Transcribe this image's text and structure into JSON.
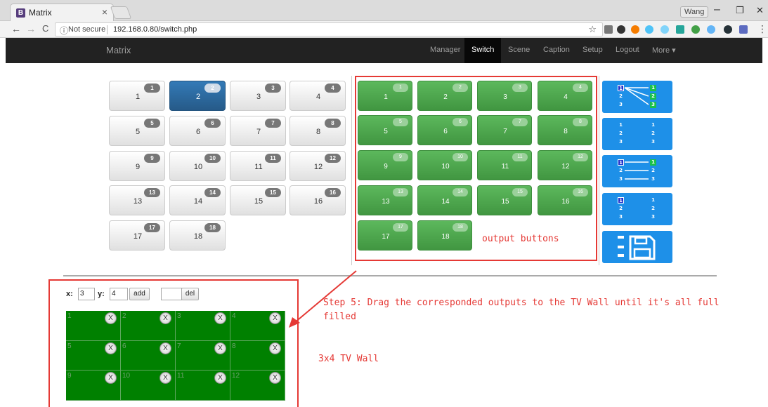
{
  "browser": {
    "tab_title": "Matrix",
    "tab_icon_letter": "B",
    "tab_close": "×",
    "user_name": "Wang",
    "window_minimize": "–",
    "window_restore": "❐",
    "window_close": "✕",
    "nav_back": "←",
    "nav_forward": "→",
    "nav_reload": "C",
    "secure_text": "Not secure",
    "url": "192.168.0.80/switch.php",
    "menu_icon": "⋮"
  },
  "navbar": {
    "brand": "Matrix",
    "links": [
      "Manager",
      "Switch",
      "Scene",
      "Caption",
      "Setup",
      "Logout",
      "More ▾"
    ],
    "active": "Switch"
  },
  "inputs": [
    {
      "label": "1",
      "badge": "1"
    },
    {
      "label": "2",
      "badge": "2",
      "active": true
    },
    {
      "label": "3",
      "badge": "3"
    },
    {
      "label": "4",
      "badge": "4"
    },
    {
      "label": "5",
      "badge": "5"
    },
    {
      "label": "6",
      "badge": "6"
    },
    {
      "label": "7",
      "badge": "7"
    },
    {
      "label": "8",
      "badge": "8"
    },
    {
      "label": "9",
      "badge": "9"
    },
    {
      "label": "10",
      "badge": "10"
    },
    {
      "label": "11",
      "badge": "11"
    },
    {
      "label": "12",
      "badge": "12"
    },
    {
      "label": "13",
      "badge": "13"
    },
    {
      "label": "14",
      "badge": "14"
    },
    {
      "label": "15",
      "badge": "15"
    },
    {
      "label": "16",
      "badge": "16"
    },
    {
      "label": "17",
      "badge": "17"
    },
    {
      "label": "18",
      "badge": "18"
    }
  ],
  "outputs": [
    {
      "label": "1",
      "badge": "1"
    },
    {
      "label": "2",
      "badge": "2"
    },
    {
      "label": "3",
      "badge": "3"
    },
    {
      "label": "4",
      "badge": "4"
    },
    {
      "label": "5",
      "badge": "5"
    },
    {
      "label": "6",
      "badge": "6"
    },
    {
      "label": "7",
      "badge": "7"
    },
    {
      "label": "8",
      "badge": "8"
    },
    {
      "label": "9",
      "badge": "9"
    },
    {
      "label": "10",
      "badge": "10"
    },
    {
      "label": "11",
      "badge": "11"
    },
    {
      "label": "12",
      "badge": "12"
    },
    {
      "label": "13",
      "badge": "13"
    },
    {
      "label": "14",
      "badge": "14"
    },
    {
      "label": "15",
      "badge": "15"
    },
    {
      "label": "16",
      "badge": "16"
    },
    {
      "label": "17",
      "badge": "17"
    },
    {
      "label": "18",
      "badge": "18"
    }
  ],
  "mode_buttons": [
    {
      "name": "one-to-all-mode-icon",
      "left": [
        "1",
        "2",
        "3"
      ],
      "right": [
        "1",
        "2",
        "3"
      ]
    },
    {
      "name": "disconnect-mode-icon",
      "left": [
        "1",
        "2",
        "3"
      ],
      "right": [
        "1",
        "2",
        "3"
      ]
    },
    {
      "name": "one-to-one-mode-icon",
      "left": [
        "1",
        "2",
        "3"
      ],
      "right": [
        "1",
        "2",
        "3"
      ]
    },
    {
      "name": "clear-mode-icon",
      "left": [
        "1",
        "2",
        "3"
      ],
      "right": [
        "1",
        "2",
        "3"
      ]
    },
    {
      "name": "save-icon"
    }
  ],
  "tvwall": {
    "x_label": "x:",
    "x_value": "3",
    "y_label": "y:",
    "y_value": "4",
    "add_label": "add",
    "del_value": "",
    "del_label": "del",
    "rows": 3,
    "cols": 4,
    "cells": [
      "1",
      "2",
      "3",
      "4",
      "5",
      "6",
      "7",
      "8",
      "9",
      "10",
      "11",
      "12"
    ],
    "remove_label": "X"
  },
  "annotations": {
    "output_buttons": "output buttons",
    "step5_line1": "Step 5: Drag the corresponded outputs to the TV Wall until it's all full",
    "step5_line2": "filled",
    "tv_wall": "3x4 TV Wall"
  },
  "colors": {
    "navbar": "#222222",
    "input_active": "#337ab7",
    "output_green": "#5cb85c",
    "mode_blue": "#1e90e8",
    "tv_wall_green": "#008000",
    "annotation_red": "#e53935"
  }
}
